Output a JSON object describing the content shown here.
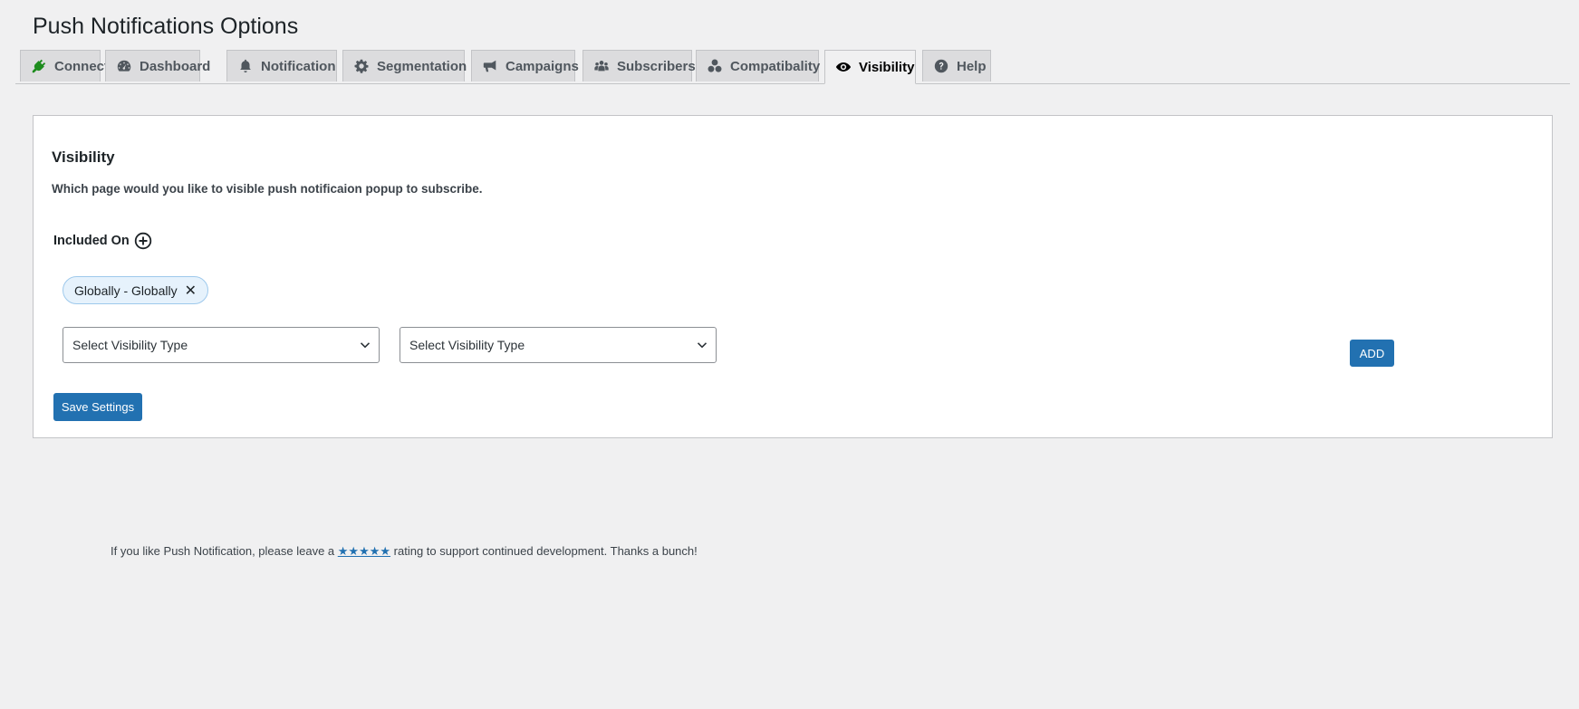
{
  "page_title": "Push Notifications Options",
  "tabs": [
    {
      "label": "Connect",
      "icon": "plug-icon",
      "active": false
    },
    {
      "label": "Dashboard",
      "icon": "dashboard-icon",
      "active": false
    },
    {
      "label": "Notification",
      "icon": "bell-icon",
      "active": false
    },
    {
      "label": "Segmentation",
      "icon": "gear-icon",
      "active": false
    },
    {
      "label": "Campaigns",
      "icon": "megaphone-icon",
      "active": false
    },
    {
      "label": "Subscribers",
      "icon": "users-icon",
      "active": false
    },
    {
      "label": "Compatibality",
      "icon": "circles-icon",
      "active": false
    },
    {
      "label": "Visibility",
      "icon": "eye-icon",
      "active": true
    },
    {
      "label": "Help",
      "icon": "help-icon",
      "active": false
    }
  ],
  "section": {
    "title": "Visibility",
    "description": "Which page would you like to visible push notificaion popup to subscribe.",
    "included_label": "Included On",
    "chip_label": "Globally - Globally",
    "chip_remove": "✕",
    "select_1": "Select Visibility Type",
    "select_2": "Select Visibility Type",
    "add_label": "ADD",
    "save_label": "Save Settings"
  },
  "footer": {
    "before": "If you like Push Notification, please leave a ",
    "stars": "★★★★★",
    "after": " rating to support continued development. Thanks a bunch!"
  },
  "colors": {
    "accent": "#2271b1",
    "plug": "#1e8c1e",
    "chip_bg": "#e6f2fc"
  }
}
